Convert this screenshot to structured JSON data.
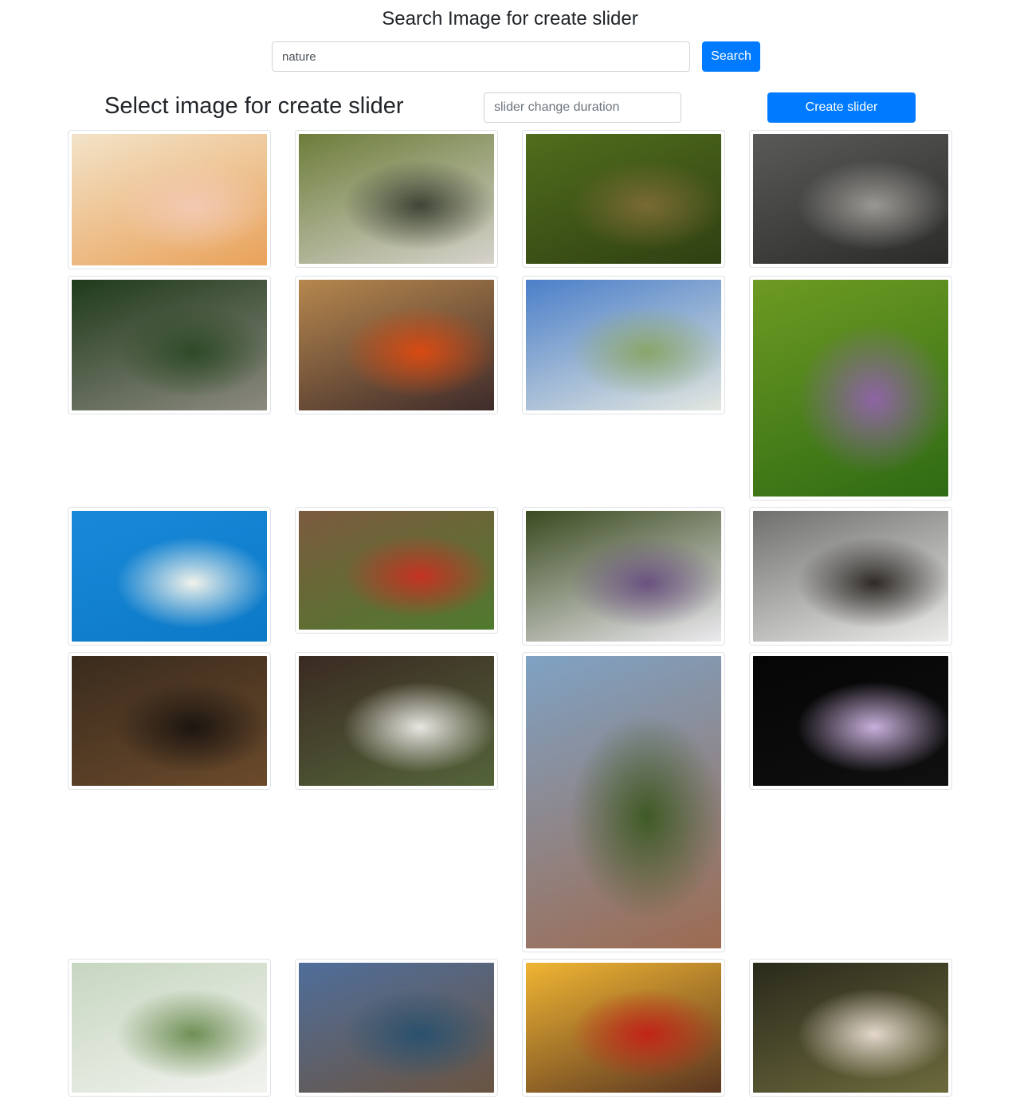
{
  "search": {
    "title": "Search Image for create slider",
    "query_value": "nature",
    "button_label": "Search"
  },
  "slider": {
    "title": "Select image for create slider",
    "duration_placeholder": "slider change duration",
    "create_label": "Create slider"
  },
  "images": [
    {
      "subject": "baby-hand",
      "colors": [
        "#f3e3c8",
        "#e9a25a",
        "#f2c9b2"
      ]
    },
    {
      "subject": "book-heart-pansy",
      "colors": [
        "#6d7d3a",
        "#d6d3cc",
        "#3f4436"
      ]
    },
    {
      "subject": "white-flower-green",
      "colors": [
        "#506d1c",
        "#2f4012",
        "#7a6a34"
      ]
    },
    {
      "subject": "abandoned-building",
      "colors": [
        "#5a5a58",
        "#2b2b2a",
        "#9a9893"
      ]
    },
    {
      "subject": "dog",
      "colors": [
        "#1f3a1b",
        "#8c8a7f",
        "#2e4a27"
      ]
    },
    {
      "subject": "sunset-sea",
      "colors": [
        "#b6874e",
        "#3e2b2a",
        "#d84a12"
      ]
    },
    {
      "subject": "white-blossom-sky",
      "colors": [
        "#4b7fc9",
        "#e3e7e0",
        "#8aa56a"
      ]
    },
    {
      "subject": "allium-flowers",
      "colors": [
        "#6d9a22",
        "#2f6b14",
        "#8e64a5"
      ]
    },
    {
      "subject": "blossom-branch-blue",
      "colors": [
        "#1889d9",
        "#0c79c6",
        "#f1f2ea"
      ]
    },
    {
      "subject": "asparagus-tomatoes",
      "colors": [
        "#7b5a3e",
        "#4f7a2e",
        "#c53222"
      ]
    },
    {
      "subject": "white-daisy",
      "colors": [
        "#3a4a1f",
        "#ecebf0",
        "#6a5280"
      ]
    },
    {
      "subject": "bald-eagle",
      "colors": [
        "#6f6f6e",
        "#ececea",
        "#2e2a26"
      ]
    },
    {
      "subject": "brown-eagle",
      "colors": [
        "#3a2b1d",
        "#6b4a2b",
        "#1c1510"
      ]
    },
    {
      "subject": "white-wildflowers",
      "colors": [
        "#3a2a22",
        "#54643a",
        "#e7e6e2"
      ]
    },
    {
      "subject": "moon-mountain",
      "colors": [
        "#7fa2c4",
        "#9d6b51",
        "#3f5a25"
      ]
    },
    {
      "subject": "purple-flower-dark",
      "colors": [
        "#050505",
        "#101010",
        "#c9b0dc"
      ]
    },
    {
      "subject": "apple-blossom",
      "colors": [
        "#c7d6c0",
        "#f2f3ef",
        "#6f8f55"
      ]
    },
    {
      "subject": "rocks-lake",
      "colors": [
        "#4f6e9b",
        "#6a5441",
        "#2a516e"
      ]
    },
    {
      "subject": "girl-poppy-field",
      "colors": [
        "#f0b533",
        "#5a3620",
        "#c22418"
      ]
    },
    {
      "subject": "woman-white-dress",
      "colors": [
        "#2a2a1c",
        "#6c6a3c",
        "#e4d8cc"
      ]
    }
  ]
}
